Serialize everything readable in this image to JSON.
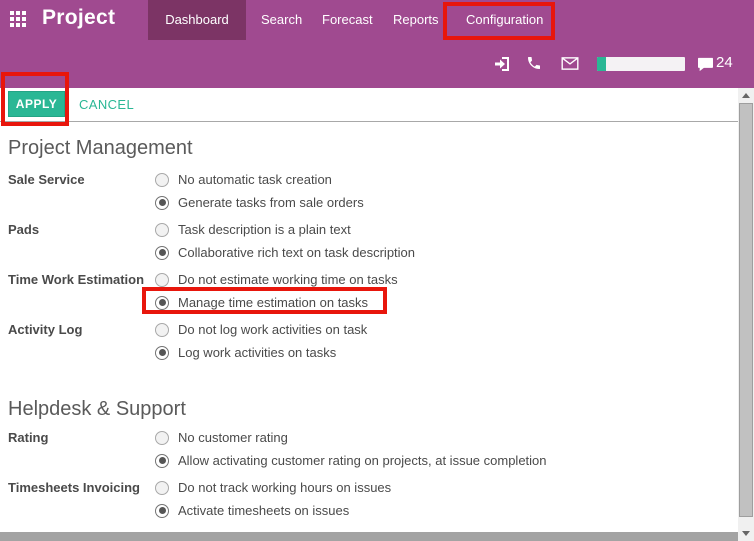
{
  "header": {
    "app_title": "Project",
    "nav": [
      {
        "label": "Dashboard",
        "active": true
      },
      {
        "label": "Search",
        "active": false
      },
      {
        "label": "Forecast",
        "active": false
      },
      {
        "label": "Reports",
        "active": false
      },
      {
        "label": "Configuration",
        "active": false,
        "highlighted": true
      }
    ],
    "icons": {
      "apps_menu": "grid-of-squares",
      "sign_in": "arrow-into-bracket",
      "phone": "phone-handset",
      "messages": "envelope-outline",
      "chat": "speech-bubble"
    },
    "progress": {
      "value_percent": 10
    },
    "chat_count": "24"
  },
  "toolbar": {
    "apply_label": "APPLY",
    "cancel_label": "CANCEL"
  },
  "sections": [
    {
      "title": "Project Management",
      "groups": [
        {
          "label": "Sale Service",
          "options": [
            {
              "text": "No automatic task creation",
              "selected": false
            },
            {
              "text": "Generate tasks from sale orders",
              "selected": true
            }
          ]
        },
        {
          "label": "Pads",
          "options": [
            {
              "text": "Task description is a plain text",
              "selected": false
            },
            {
              "text": "Collaborative rich text on task description",
              "selected": true
            }
          ]
        },
        {
          "label": "Time Work Estimation",
          "options": [
            {
              "text": "Do not estimate working time on tasks",
              "selected": false
            },
            {
              "text": "Manage time estimation on tasks",
              "selected": true,
              "highlighted": true
            }
          ]
        },
        {
          "label": "Activity Log",
          "options": [
            {
              "text": "Do not log work activities on task",
              "selected": false
            },
            {
              "text": "Log work activities on tasks",
              "selected": true
            }
          ]
        }
      ]
    },
    {
      "title": "Helpdesk & Support",
      "groups": [
        {
          "label": "Rating",
          "options": [
            {
              "text": "No customer rating",
              "selected": false
            },
            {
              "text": "Allow activating customer rating on projects, at issue completion",
              "selected": true
            }
          ]
        },
        {
          "label": "Timesheets Invoicing",
          "options": [
            {
              "text": "Do not track working hours on issues",
              "selected": false
            },
            {
              "text": "Activate timesheets on issues",
              "selected": true
            }
          ]
        }
      ]
    }
  ],
  "colors": {
    "header_bg": "#a04a90",
    "active_tab_bg": "#7c3465",
    "accent_teal": "#2ab795",
    "highlight_red": "#e8160c"
  }
}
